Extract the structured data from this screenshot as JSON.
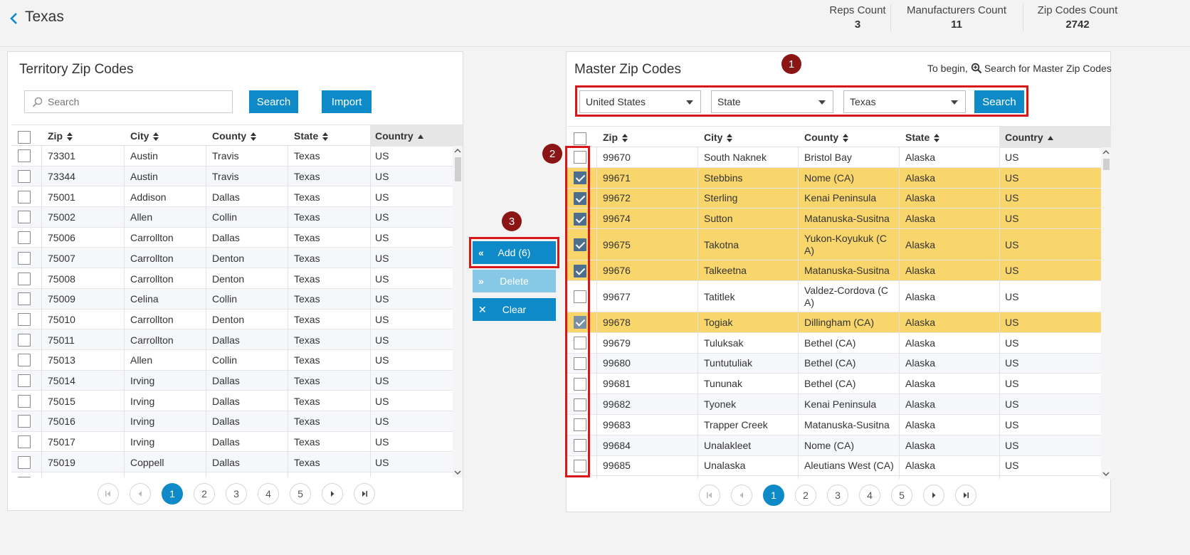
{
  "header": {
    "title": "Texas",
    "stats": [
      {
        "label": "Reps Count",
        "value": "3"
      },
      {
        "label": "Manufacturers Count",
        "value": "11"
      },
      {
        "label": "Zip Codes Count",
        "value": "2742"
      }
    ]
  },
  "territory": {
    "title": "Territory Zip Codes",
    "search_placeholder": "Search",
    "search_label": "Search",
    "import_label": "Import",
    "columns": [
      "Zip",
      "City",
      "County",
      "State",
      "Country"
    ],
    "rows": [
      [
        "73301",
        "Austin",
        "Travis",
        "Texas",
        "US"
      ],
      [
        "73344",
        "Austin",
        "Travis",
        "Texas",
        "US"
      ],
      [
        "75001",
        "Addison",
        "Dallas",
        "Texas",
        "US"
      ],
      [
        "75002",
        "Allen",
        "Collin",
        "Texas",
        "US"
      ],
      [
        "75006",
        "Carrollton",
        "Dallas",
        "Texas",
        "US"
      ],
      [
        "75007",
        "Carrollton",
        "Denton",
        "Texas",
        "US"
      ],
      [
        "75008",
        "Carrollton",
        "Denton",
        "Texas",
        "US"
      ],
      [
        "75009",
        "Celina",
        "Collin",
        "Texas",
        "US"
      ],
      [
        "75010",
        "Carrollton",
        "Denton",
        "Texas",
        "US"
      ],
      [
        "75011",
        "Carrollton",
        "Dallas",
        "Texas",
        "US"
      ],
      [
        "75013",
        "Allen",
        "Collin",
        "Texas",
        "US"
      ],
      [
        "75014",
        "Irving",
        "Dallas",
        "Texas",
        "US"
      ],
      [
        "75015",
        "Irving",
        "Dallas",
        "Texas",
        "US"
      ],
      [
        "75016",
        "Irving",
        "Dallas",
        "Texas",
        "US"
      ],
      [
        "75017",
        "Irving",
        "Dallas",
        "Texas",
        "US"
      ],
      [
        "75019",
        "Coppell",
        "Dallas",
        "Texas",
        "US"
      ]
    ],
    "pages": [
      "1",
      "2",
      "3",
      "4",
      "5"
    ]
  },
  "actions": {
    "add_label": "Add (6)",
    "delete_label": "Delete",
    "clear_label": "Clear"
  },
  "master": {
    "title": "Master Zip Codes",
    "hint_prefix": "To begin,",
    "hint_text": "Search for Master Zip Codes",
    "filters": {
      "country": "United States",
      "level": "State",
      "state": "Texas"
    },
    "search_label": "Search",
    "columns": [
      "Zip",
      "City",
      "County",
      "State",
      "Country"
    ],
    "rows": [
      {
        "zip": "99670",
        "city": "South Naknek",
        "county": "Bristol Bay",
        "state": "Alaska",
        "country": "US",
        "checked": false
      },
      {
        "zip": "99671",
        "city": "Stebbins",
        "county": "Nome (CA)",
        "state": "Alaska",
        "country": "US",
        "checked": true
      },
      {
        "zip": "99672",
        "city": "Sterling",
        "county": "Kenai Peninsula",
        "state": "Alaska",
        "country": "US",
        "checked": true
      },
      {
        "zip": "99674",
        "city": "Sutton",
        "county": "Matanuska-Susitna",
        "state": "Alaska",
        "country": "US",
        "checked": true
      },
      {
        "zip": "99675",
        "city": "Takotna",
        "county": "Yukon-Koyukuk (C A)",
        "state": "Alaska",
        "country": "US",
        "checked": true
      },
      {
        "zip": "99676",
        "city": "Talkeetna",
        "county": "Matanuska-Susitna",
        "state": "Alaska",
        "country": "US",
        "checked": true
      },
      {
        "zip": "99677",
        "city": "Tatitlek",
        "county": "Valdez-Cordova (C A)",
        "state": "Alaska",
        "country": "US",
        "checked": false
      },
      {
        "zip": "99678",
        "city": "Togiak",
        "county": "Dillingham (CA)",
        "state": "Alaska",
        "country": "US",
        "checked": true
      },
      {
        "zip": "99679",
        "city": "Tuluksak",
        "county": "Bethel (CA)",
        "state": "Alaska",
        "country": "US",
        "checked": false
      },
      {
        "zip": "99680",
        "city": "Tuntutuliak",
        "county": "Bethel (CA)",
        "state": "Alaska",
        "country": "US",
        "checked": false
      },
      {
        "zip": "99681",
        "city": "Tununak",
        "county": "Bethel (CA)",
        "state": "Alaska",
        "country": "US",
        "checked": false
      },
      {
        "zip": "99682",
        "city": "Tyonek",
        "county": "Kenai Peninsula",
        "state": "Alaska",
        "country": "US",
        "checked": false
      },
      {
        "zip": "99683",
        "city": "Trapper Creek",
        "county": "Matanuska-Susitna",
        "state": "Alaska",
        "country": "US",
        "checked": false
      },
      {
        "zip": "99684",
        "city": "Unalakleet",
        "county": "Nome (CA)",
        "state": "Alaska",
        "country": "US",
        "checked": false
      },
      {
        "zip": "99685",
        "city": "Unalaska",
        "county": "Aleutians West (CA)",
        "state": "Alaska",
        "country": "US",
        "checked": false
      }
    ],
    "pages": [
      "1",
      "2",
      "3",
      "4",
      "5"
    ]
  },
  "annotations": [
    "1",
    "2",
    "3"
  ],
  "colors": {
    "primary": "#0d8ac7",
    "selected_row": "#f9d66c",
    "annotation": "#8b1515",
    "highlight_box": "#d81818"
  },
  "icons": {
    "back": "chevron-left-icon",
    "search": "magnifier-icon",
    "add": "double-chevron-left-icon",
    "delete": "double-chevron-right-icon",
    "clear": "close-icon"
  }
}
